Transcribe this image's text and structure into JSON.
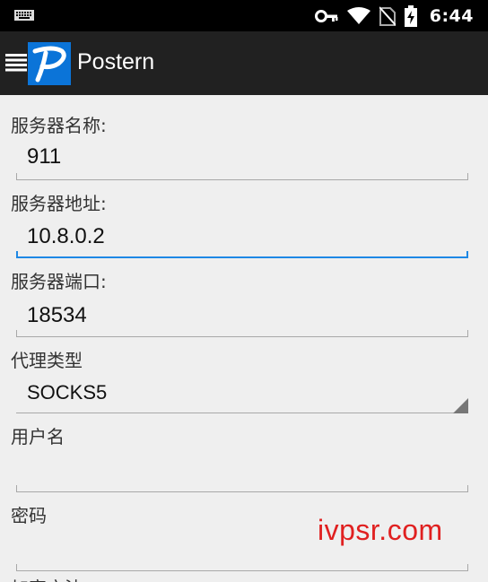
{
  "statusbar": {
    "time": "6:44",
    "icons": [
      "keyboard-icon",
      "vpn-key-icon",
      "wifi-icon",
      "no-sim-icon",
      "battery-charging-icon"
    ]
  },
  "toolbar": {
    "title": "Postern",
    "logo_letter": "P",
    "logo_color": "#0b74d8"
  },
  "form": {
    "server_name_label": "服务器名称:",
    "server_name_value": "911",
    "server_address_label": "服务器地址:",
    "server_address_value": "10.8.0.2",
    "server_port_label": "服务器端口:",
    "server_port_value": "18534",
    "proxy_type_label": "代理类型",
    "proxy_type_value": "SOCKS5",
    "username_label": "用户名",
    "username_value": "",
    "password_label": "密码",
    "password_value": "",
    "next_label_partial": "加密方法"
  },
  "watermark": "ivpsr.com",
  "colors": {
    "accent": "#1e88e5",
    "toolbar": "#212121",
    "statusbar": "#000000",
    "watermark": "#e02020"
  }
}
